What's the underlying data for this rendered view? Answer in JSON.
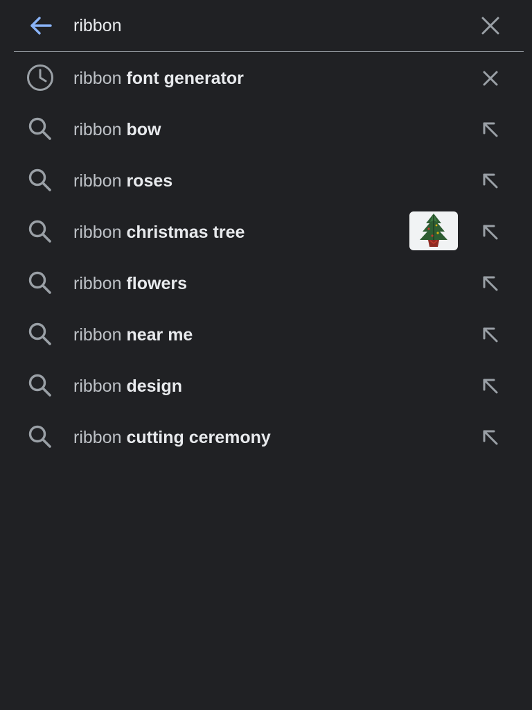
{
  "search": {
    "query": "ribbon",
    "back_icon": "arrow-back-icon",
    "clear_icon": "close-icon"
  },
  "colors": {
    "background": "#202124",
    "accent": "#8ab4f8",
    "text": "#e8eaed",
    "muted_text": "#bdc1c6",
    "icon": "#9aa0a6"
  },
  "suggestions": [
    {
      "prefix": "ribbon ",
      "completion": "font generator",
      "icon": "history-icon",
      "action": "remove-icon"
    },
    {
      "prefix": "ribbon ",
      "completion": "bow",
      "icon": "search-icon",
      "action": "fill-query-arrow-icon"
    },
    {
      "prefix": "ribbon ",
      "completion": "roses",
      "icon": "search-icon",
      "action": "fill-query-arrow-icon"
    },
    {
      "prefix": "ribbon ",
      "completion": "christmas tree",
      "icon": "search-icon",
      "action": "fill-query-arrow-icon",
      "thumbnail": "christmas-tree-image"
    },
    {
      "prefix": "ribbon ",
      "completion": "flowers",
      "icon": "search-icon",
      "action": "fill-query-arrow-icon"
    },
    {
      "prefix": "ribbon ",
      "completion": "near me",
      "icon": "search-icon",
      "action": "fill-query-arrow-icon"
    },
    {
      "prefix": "ribbon ",
      "completion": "design",
      "icon": "search-icon",
      "action": "fill-query-arrow-icon"
    },
    {
      "prefix": "ribbon ",
      "completion": "cutting ceremony",
      "icon": "search-icon",
      "action": "fill-query-arrow-icon"
    }
  ]
}
